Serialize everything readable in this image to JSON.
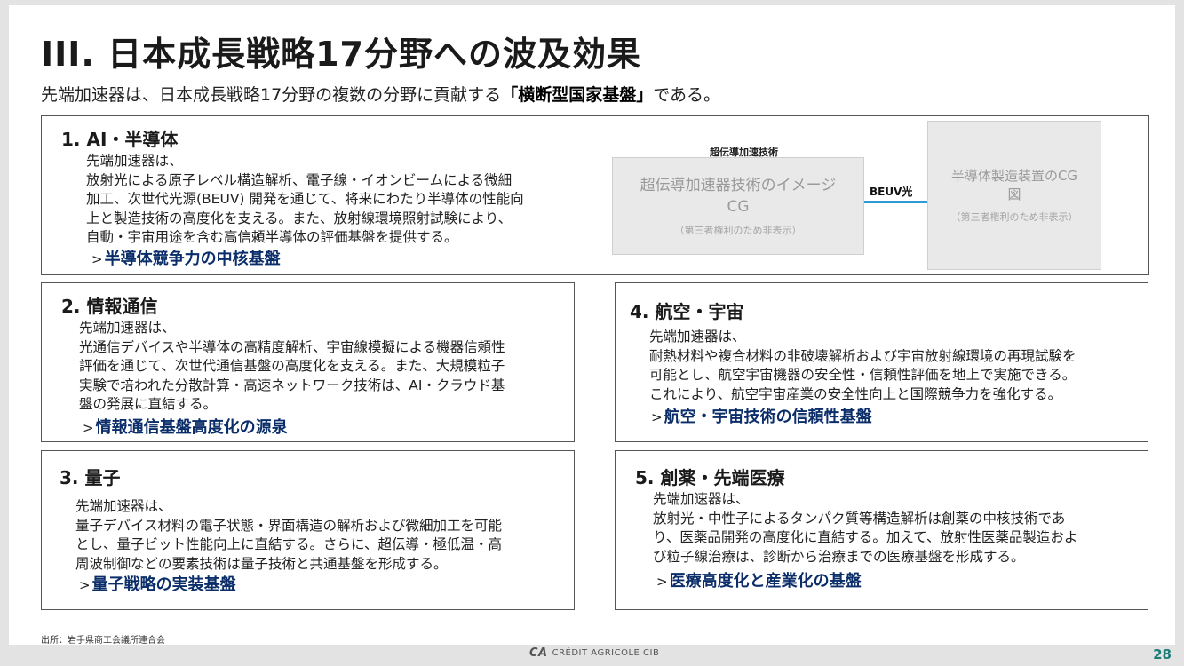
{
  "title": "III. 日本成長戦略17分野への波及効果",
  "subtitle": {
    "pre": "先端加速器は、日本成長戦略17分野の複数の分野に貢献する",
    "bold": "「横断型国家基盤」",
    "post": "である。"
  },
  "sections": {
    "s1": {
      "heading": "1. AI・半導体",
      "lines": [
        "先端加速器は、",
        "放射光による原子レベル構造解析、電子線・イオンビームによる微細",
        "加工、次世代光源(BEUV) 開発を通じて、将来にわたり半導体の性能向",
        "上と製造技術の高度化を支える。また、放射線環境照射試験により、",
        "自動・宇宙用途を含む高信頼半導体の評価基盤を提供する。"
      ],
      "arrow": ">",
      "tagline": "半導体競争力の中核基盤"
    },
    "s2": {
      "heading": "2. 情報通信",
      "lines": [
        "先端加速器は、",
        "光通信デバイスや半導体の高精度解析、宇宙線模擬による機器信頼性",
        "評価を通じて、次世代通信基盤の高度化を支える。また、大規模粒子",
        "実験で培われた分散計算・高速ネットワーク技術は、AI・クラウド基",
        "盤の発展に直結する。"
      ],
      "arrow": ">",
      "tagline": "情報通信基盤高度化の源泉"
    },
    "s3": {
      "heading": "3. 量子",
      "lines": [
        "先端加速器は、",
        "量子デバイス材料の電子状態・界面構造の解析および微細加工を可能",
        "とし、量子ビット性能向上に直結する。さらに、超伝導・極低温・高",
        "周波制御などの要素技術は量子技術と共通基盤を形成する。"
      ],
      "arrow": ">",
      "tagline": "量子戦略の実装基盤"
    },
    "s4": {
      "heading": "4. 航空・宇宙",
      "lines": [
        "先端加速器は、",
        "耐熱材料や複合材料の非破壊解析および宇宙放射線環境の再現試験を",
        "可能とし、航空宇宙機器の安全性・信頼性評価を地上で実施できる。",
        "これにより、航空宇宙産業の安全性向上と国際競争力を強化する。"
      ],
      "arrow": ">",
      "tagline": "航空・宇宙技術の信頼性基盤"
    },
    "s5": {
      "heading": "5. 創薬・先端医療",
      "lines": [
        "先端加速器は、",
        "放射光・中性子によるタンパク質等構造解析は創薬の中核技術であ",
        "り、医薬品開発の高度化に直結する。加えて、放射性医薬品製造およ",
        "び粒子線治療は、診断から治療までの医療基盤を形成する。"
      ],
      "arrow": ">",
      "tagline": "医療高度化と産業化の基盤"
    }
  },
  "figure": {
    "left_caption": "超伝導加速技術",
    "left_image": {
      "line1": "超伝導加速器技術のイメージ",
      "line2": "CG",
      "note": "（第三者権利のため非表示）"
    },
    "connector_label": "BEUV光",
    "connector_color": "#2f9bd6",
    "right_image": {
      "line1": "半導体製造装置のCG",
      "line2": "図",
      "note": "（第三者権利のため非表示）"
    }
  },
  "footer": {
    "source": "出所：岩手県商工会議所連合会",
    "brand": "CRÉDIT AGRICOLE CIB",
    "brand_logo": "CA",
    "page_number": "28"
  },
  "colors": {
    "tagline": "#0b2e6a",
    "page_number": "#1e7c77"
  }
}
